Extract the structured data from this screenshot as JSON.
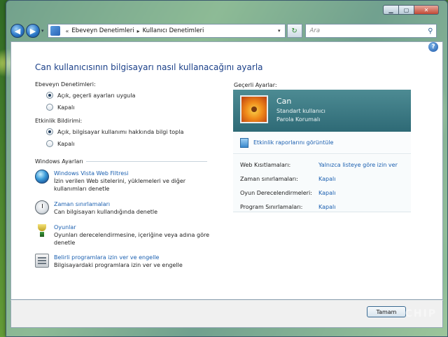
{
  "window": {
    "caption": {
      "minimize": "▁",
      "maximize": "▢",
      "close": "✕"
    }
  },
  "nav": {
    "back_glyph": "◀",
    "forward_glyph": "▶",
    "dropdown_glyph": "▾",
    "address_chevron": "«",
    "breadcrumb": [
      "Ebeveyn Denetimleri",
      "Kullanıcı Denetimleri"
    ],
    "breadcrumb_separator": "▸",
    "refresh_glyph": "↻",
    "search_placeholder": "Ara",
    "search_glyph": "⚲"
  },
  "help": {
    "glyph": "?"
  },
  "main": {
    "title": "Can kullanıcısının bilgisayarı nasıl kullanacağını ayarla",
    "parental_controls": {
      "label": "Ebeveyn Denetimleri:",
      "options": [
        {
          "label": "Açık, geçerli ayarları uygula",
          "checked": true
        },
        {
          "label": "Kapalı",
          "checked": false
        }
      ]
    },
    "activity_reporting": {
      "label": "Etkinlik Bildirimi:",
      "options": [
        {
          "label": "Açık, bilgisayar kullanımı hakkında bilgi topla",
          "checked": true
        },
        {
          "label": "Kapalı",
          "checked": false
        }
      ]
    },
    "windows_settings": {
      "label": "Windows Ayarları",
      "items": [
        {
          "icon": "globe-icon",
          "link": "Windows Vista Web Filtresi",
          "desc": [
            "İzin verilen Web sitelerini, yüklemeleri ve diğer",
            "kullanımları denetle"
          ]
        },
        {
          "icon": "clock-icon",
          "link": "Zaman sınırlamaları",
          "desc": [
            "Can bilgisayarı kullandığında denetle"
          ]
        },
        {
          "icon": "trophy-icon",
          "link": "Oyunlar",
          "desc": [
            "Oyunları derecelendirmesine, içeriğine veya adına göre",
            "denetle"
          ]
        },
        {
          "icon": "programs-icon",
          "link": "Belirli programlara izin ver ve engelle",
          "desc": [
            "Bilgisayardaki programlara izin ver ve engelle"
          ]
        }
      ]
    }
  },
  "current_settings": {
    "label": "Geçerli Ayarlar:",
    "user": {
      "name": "Can",
      "type": "Standart kullanıcı",
      "password": "Parola Korumalı"
    },
    "reports_link": "Etkinlik raporlarını görüntüle",
    "rows": [
      {
        "label": "Web Kısıtlamaları:",
        "value": "Yalnızca listeye göre izin ver"
      },
      {
        "label": "Zaman sınırlamaları:",
        "value": "Kapalı"
      },
      {
        "label": "Oyun Derecelendirmeleri:",
        "value": "Kapalı"
      },
      {
        "label": "Program Sınırlamaları:",
        "value": "Kapalı"
      }
    ]
  },
  "footer": {
    "ok_label": "Tamam"
  },
  "watermark": "CHIP",
  "colors": {
    "link": "#1a5fb0",
    "title": "#1a3f88",
    "user_card": "#3f7b86"
  }
}
